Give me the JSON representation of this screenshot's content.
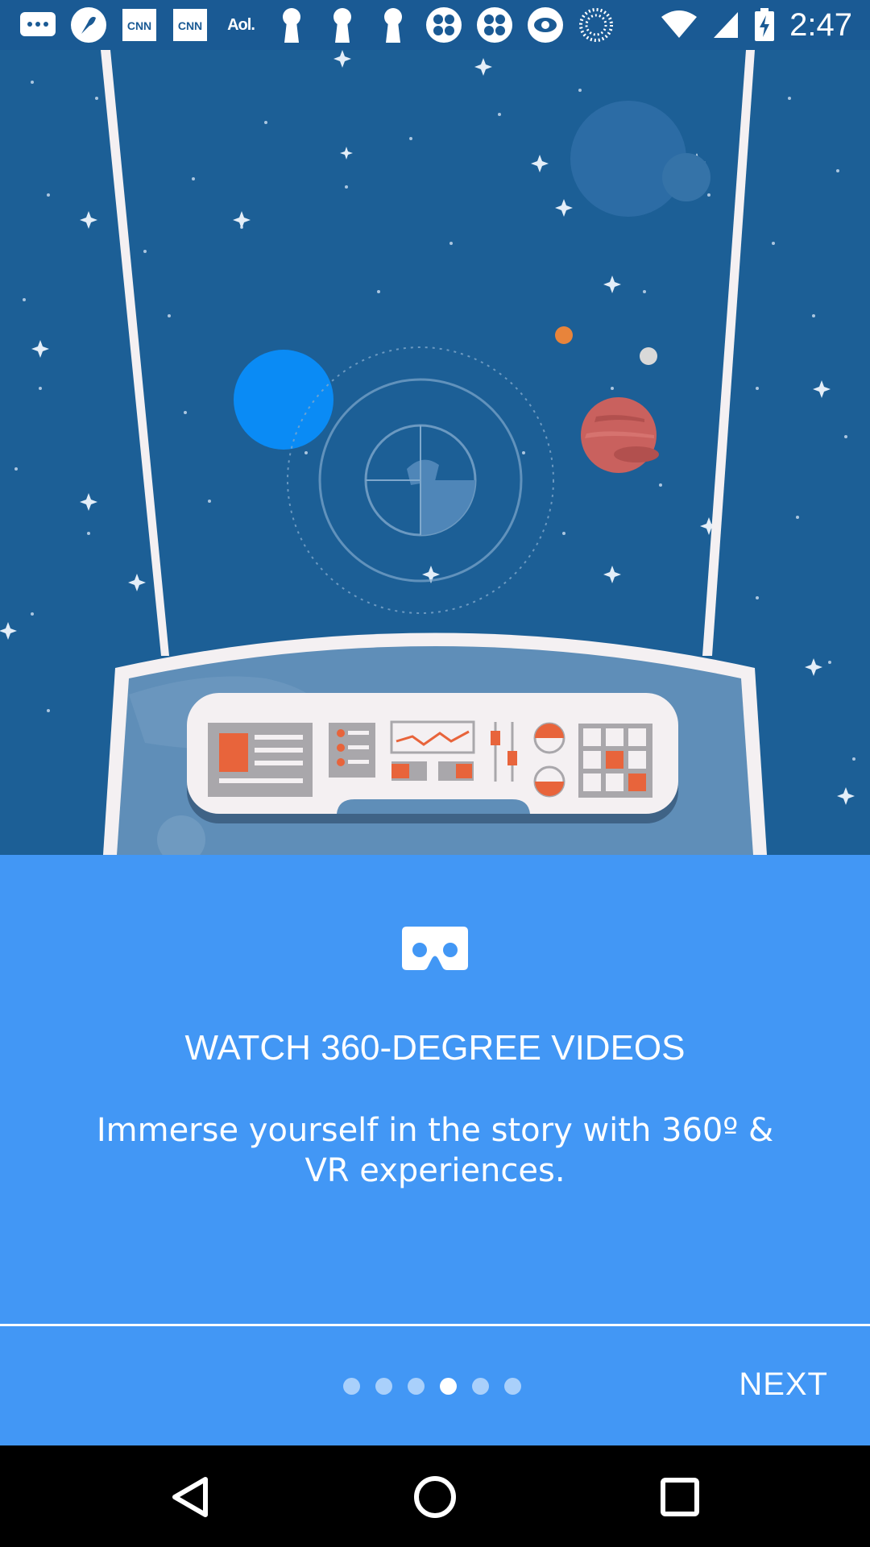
{
  "status_bar": {
    "time": "2:47",
    "notification_icons": [
      "messages-icon",
      "fan-icon",
      "cnn-icon",
      "cnn-icon",
      "aol-icon",
      "keyhole-icon",
      "keyhole-icon",
      "keyhole-icon",
      "clover-icon",
      "clover-icon",
      "eye-icon",
      "dotted-circle-icon"
    ],
    "cnn_text": "CNN",
    "aol_text": "Aol.",
    "system_icons": [
      "wifi-icon",
      "signal-icon",
      "battery-charging-icon"
    ]
  },
  "onboarding": {
    "icon": "vr-headset-icon",
    "title": "WATCH 360-DEGREE VIDEOS",
    "description": "Immerse yourself in the story with 360º & VR experiences.",
    "page_total": 6,
    "page_current": 4,
    "next_label": "NEXT"
  },
  "nav_bar": {
    "buttons": [
      "back-icon",
      "home-icon",
      "recents-icon"
    ]
  },
  "colors": {
    "status_bar": "#1a5a94",
    "space": "#1c5f96",
    "panel": "#4297f5",
    "accent_orange": "#e8643b"
  }
}
